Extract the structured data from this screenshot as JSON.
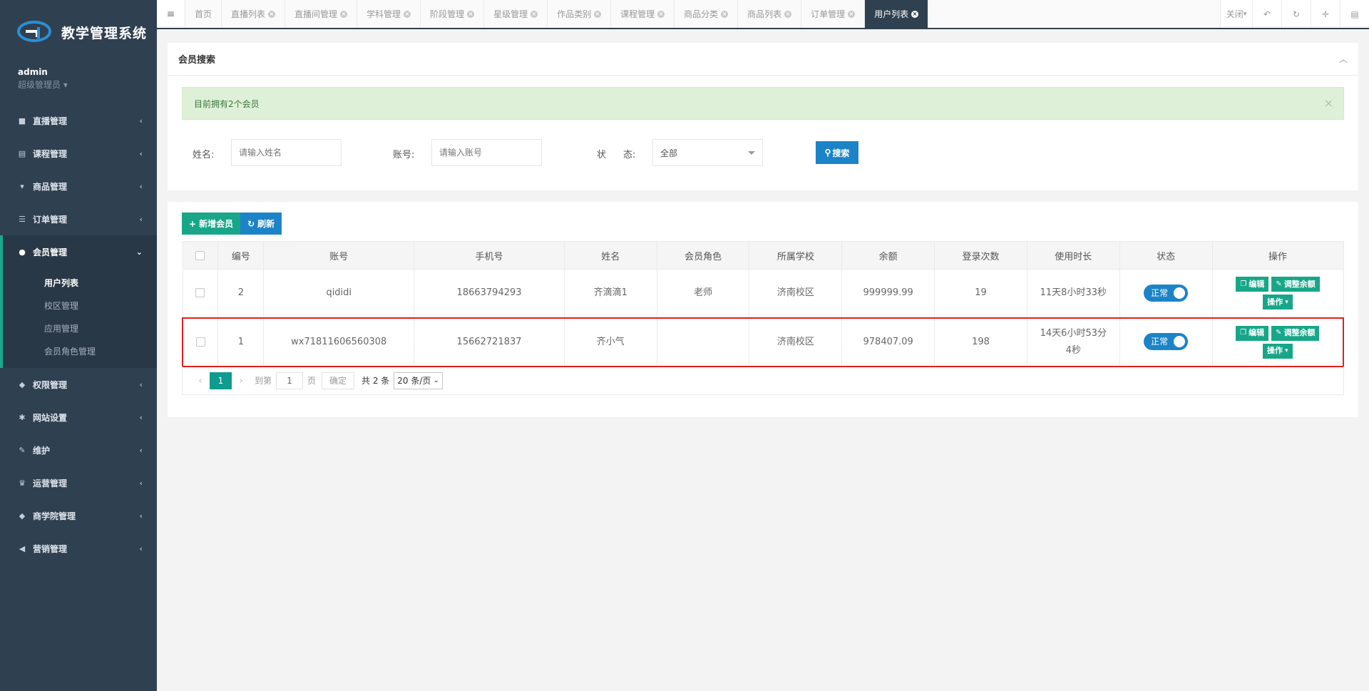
{
  "app": {
    "title": "教学管理系统"
  },
  "user": {
    "name": "admin",
    "role": "超级管理员"
  },
  "sidebar": {
    "items": [
      {
        "label": "直播管理",
        "icon": "video-camera-icon"
      },
      {
        "label": "课程管理",
        "icon": "book-icon"
      },
      {
        "label": "商品管理",
        "icon": "cart-icon"
      },
      {
        "label": "订单管理",
        "icon": "list-icon"
      },
      {
        "label": "会员管理",
        "icon": "user-icon"
      },
      {
        "label": "权限管理",
        "icon": "users-icon"
      },
      {
        "label": "网站设置",
        "icon": "gear-icon"
      },
      {
        "label": "维护",
        "icon": "wrench-icon"
      },
      {
        "label": "运营管理",
        "icon": "trophy-icon"
      },
      {
        "label": "商学院管理",
        "icon": "users-icon"
      },
      {
        "label": "营销管理",
        "icon": "bullhorn-icon"
      }
    ],
    "sub_items": [
      "用户列表",
      "校区管理",
      "应用管理",
      "会员角色管理"
    ]
  },
  "tabs": [
    "首页",
    "直播列表",
    "直播间管理",
    "学科管理",
    "阶段管理",
    "星级管理",
    "作品类别",
    "课程管理",
    "商品分类",
    "商品列表",
    "订单管理",
    "用户列表"
  ],
  "topbar": {
    "close_label": "关闭"
  },
  "search": {
    "panel_title": "会员搜索",
    "alert_text": "目前拥有2个会员",
    "name_label": "姓名:",
    "name_placeholder": "请输入姓名",
    "account_label": "账号:",
    "account_placeholder": "请输入账号",
    "status_label_1": "状",
    "status_label_2": "态:",
    "status_value": "全部",
    "search_button": "搜索"
  },
  "toolbar": {
    "add_label": "新增会员",
    "refresh_label": "刷新"
  },
  "table": {
    "columns": [
      "编号",
      "账号",
      "手机号",
      "姓名",
      "会员角色",
      "所属学校",
      "余额",
      "登录次数",
      "使用时长",
      "状态",
      "操作"
    ],
    "rows": [
      {
        "id": "2",
        "account": "qididi",
        "phone": "18663794293",
        "name": "齐滴滴1",
        "role": "老师",
        "school": "济南校区",
        "balance": "999999.99",
        "logins": "19",
        "duration": "11天8小时33秒",
        "status": "正常"
      },
      {
        "id": "1",
        "account": "wx71811606560308",
        "phone": "15662721837",
        "name": "齐小气",
        "role": "",
        "school": "济南校区",
        "balance": "978407.09",
        "logins": "198",
        "duration": "14天6小时53分4秒",
        "status": "正常"
      }
    ],
    "edit_label": "编辑",
    "adjust_label": "调整余额",
    "ops_label": "操作"
  },
  "pager": {
    "current_page": "1",
    "goto_label": "到第",
    "goto_value": "1",
    "page_label": "页",
    "confirm_label": "确定",
    "total_label": "共 2 条",
    "page_size": "20 条/页"
  },
  "colors": {
    "sidebar": "#2f4050",
    "primary_green": "#18a689",
    "primary_blue": "#1c84c6",
    "highlight_border": "#e02020"
  }
}
